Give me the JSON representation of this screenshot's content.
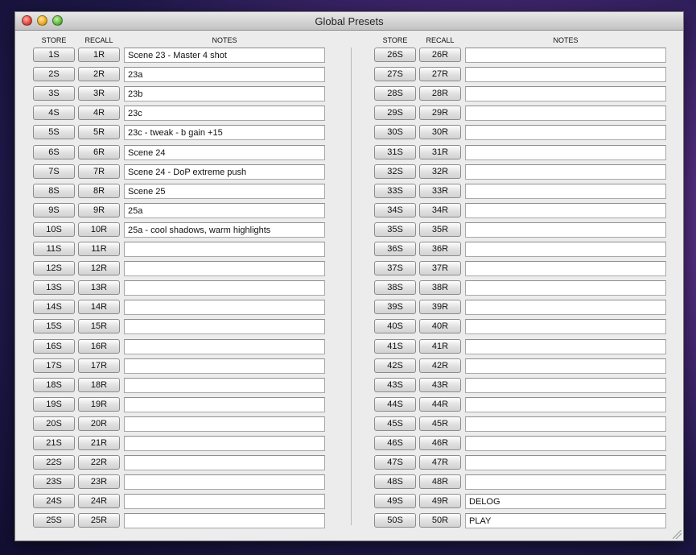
{
  "window": {
    "title": "Global Presets"
  },
  "headers": {
    "store": "STORE",
    "recall": "RECALL",
    "notes": "NOTES"
  },
  "left": [
    {
      "store": "1S",
      "recall": "1R",
      "note": "Scene 23 - Master 4 shot"
    },
    {
      "store": "2S",
      "recall": "2R",
      "note": "23a"
    },
    {
      "store": "3S",
      "recall": "3R",
      "note": "23b"
    },
    {
      "store": "4S",
      "recall": "4R",
      "note": "23c"
    },
    {
      "store": "5S",
      "recall": "5R",
      "note": "23c - tweak - b gain +15"
    },
    {
      "store": "6S",
      "recall": "6R",
      "note": "Scene 24"
    },
    {
      "store": "7S",
      "recall": "7R",
      "note": "Scene 24 - DoP extreme push"
    },
    {
      "store": "8S",
      "recall": "8R",
      "note": "Scene 25"
    },
    {
      "store": "9S",
      "recall": "9R",
      "note": "25a"
    },
    {
      "store": "10S",
      "recall": "10R",
      "note": "25a - cool shadows, warm highlights"
    },
    {
      "store": "11S",
      "recall": "11R",
      "note": ""
    },
    {
      "store": "12S",
      "recall": "12R",
      "note": ""
    },
    {
      "store": "13S",
      "recall": "13R",
      "note": ""
    },
    {
      "store": "14S",
      "recall": "14R",
      "note": ""
    },
    {
      "store": "15S",
      "recall": "15R",
      "note": ""
    },
    {
      "store": "16S",
      "recall": "16R",
      "note": ""
    },
    {
      "store": "17S",
      "recall": "17R",
      "note": ""
    },
    {
      "store": "18S",
      "recall": "18R",
      "note": ""
    },
    {
      "store": "19S",
      "recall": "19R",
      "note": ""
    },
    {
      "store": "20S",
      "recall": "20R",
      "note": ""
    },
    {
      "store": "21S",
      "recall": "21R",
      "note": ""
    },
    {
      "store": "22S",
      "recall": "22R",
      "note": ""
    },
    {
      "store": "23S",
      "recall": "23R",
      "note": ""
    },
    {
      "store": "24S",
      "recall": "24R",
      "note": ""
    },
    {
      "store": "25S",
      "recall": "25R",
      "note": ""
    }
  ],
  "right": [
    {
      "store": "26S",
      "recall": "26R",
      "note": ""
    },
    {
      "store": "27S",
      "recall": "27R",
      "note": ""
    },
    {
      "store": "28S",
      "recall": "28R",
      "note": ""
    },
    {
      "store": "29S",
      "recall": "29R",
      "note": ""
    },
    {
      "store": "30S",
      "recall": "30R",
      "note": ""
    },
    {
      "store": "31S",
      "recall": "31R",
      "note": ""
    },
    {
      "store": "32S",
      "recall": "32R",
      "note": ""
    },
    {
      "store": "33S",
      "recall": "33R",
      "note": ""
    },
    {
      "store": "34S",
      "recall": "34R",
      "note": ""
    },
    {
      "store": "35S",
      "recall": "35R",
      "note": ""
    },
    {
      "store": "36S",
      "recall": "36R",
      "note": ""
    },
    {
      "store": "37S",
      "recall": "37R",
      "note": ""
    },
    {
      "store": "38S",
      "recall": "38R",
      "note": ""
    },
    {
      "store": "39S",
      "recall": "39R",
      "note": ""
    },
    {
      "store": "40S",
      "recall": "40R",
      "note": ""
    },
    {
      "store": "41S",
      "recall": "41R",
      "note": ""
    },
    {
      "store": "42S",
      "recall": "42R",
      "note": ""
    },
    {
      "store": "43S",
      "recall": "43R",
      "note": ""
    },
    {
      "store": "44S",
      "recall": "44R",
      "note": ""
    },
    {
      "store": "45S",
      "recall": "45R",
      "note": ""
    },
    {
      "store": "46S",
      "recall": "46R",
      "note": ""
    },
    {
      "store": "47S",
      "recall": "47R",
      "note": ""
    },
    {
      "store": "48S",
      "recall": "48R",
      "note": ""
    },
    {
      "store": "49S",
      "recall": "49R",
      "note": "DELOG"
    },
    {
      "store": "50S",
      "recall": "50R",
      "note": "PLAY"
    }
  ]
}
